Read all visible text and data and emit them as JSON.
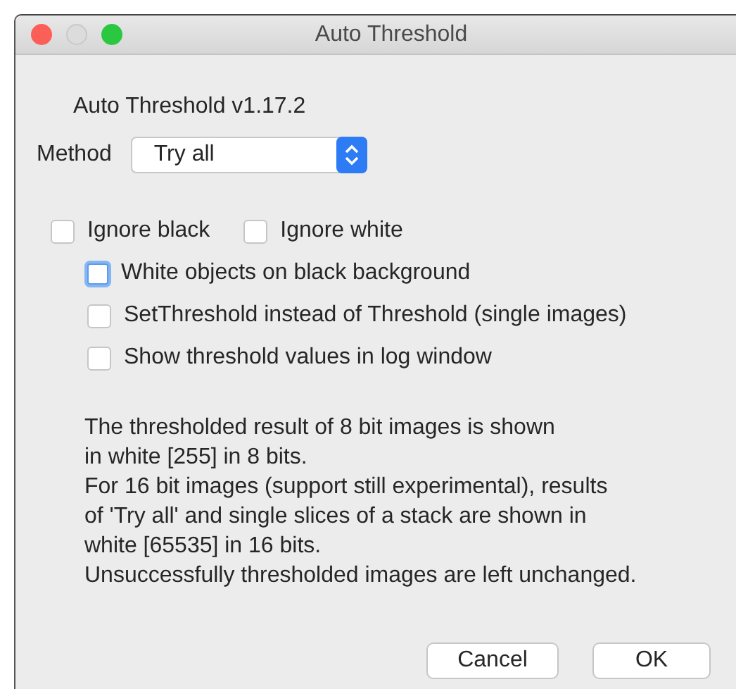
{
  "window": {
    "title": "Auto Threshold"
  },
  "version": "Auto Threshold v1.17.2",
  "method": {
    "label": "Method",
    "value": "Try all"
  },
  "checkbox_rows": [
    [
      {
        "label": "Ignore black",
        "checked": false,
        "focused": false
      },
      {
        "label": "Ignore white",
        "checked": false,
        "focused": false
      }
    ],
    [
      {
        "label": "White objects on black background",
        "checked": false,
        "focused": true
      }
    ],
    [
      {
        "label": "SetThreshold instead of Threshold (single images)",
        "checked": false,
        "focused": false
      }
    ],
    [
      {
        "label": "Show threshold values in log window",
        "checked": false,
        "focused": false
      }
    ]
  ],
  "info_lines": [
    "The thresholded result of 8 bit images is shown",
    "in white [255] in 8 bits.",
    "For 16 bit images (support still experimental), results",
    "of 'Try all' and single slices of a stack are shown in",
    "white [65535] in 16 bits.",
    "Unsuccessfully thresholded images are left unchanged."
  ],
  "buttons": [
    "Cancel",
    "OK"
  ]
}
